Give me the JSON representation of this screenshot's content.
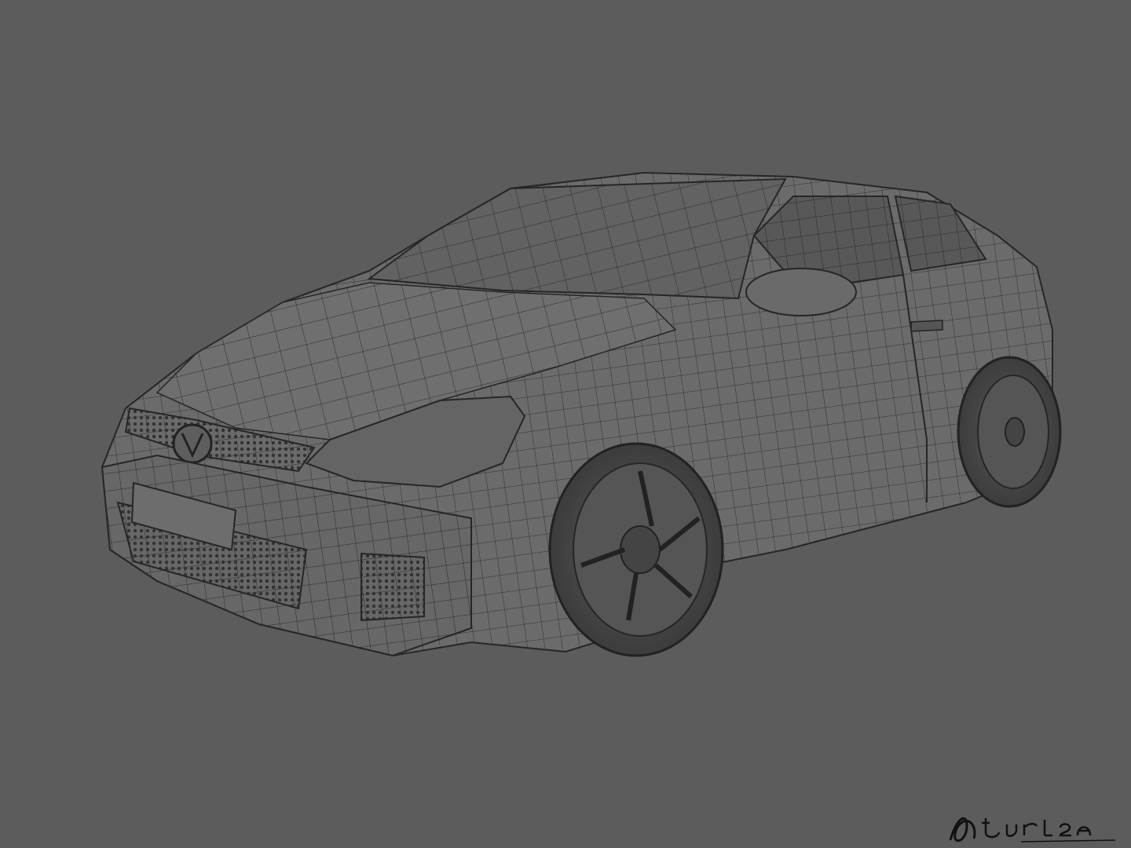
{
  "viewport": {
    "background_color": "#5c5c5c",
    "subject": "car-wireframe-render"
  },
  "model": {
    "body_color": "#6e6e6e",
    "wire_color": "#2a2a2a",
    "shadow_color": "#4a4a4a"
  },
  "signature": {
    "text": "Burlea",
    "color": "#111111"
  }
}
